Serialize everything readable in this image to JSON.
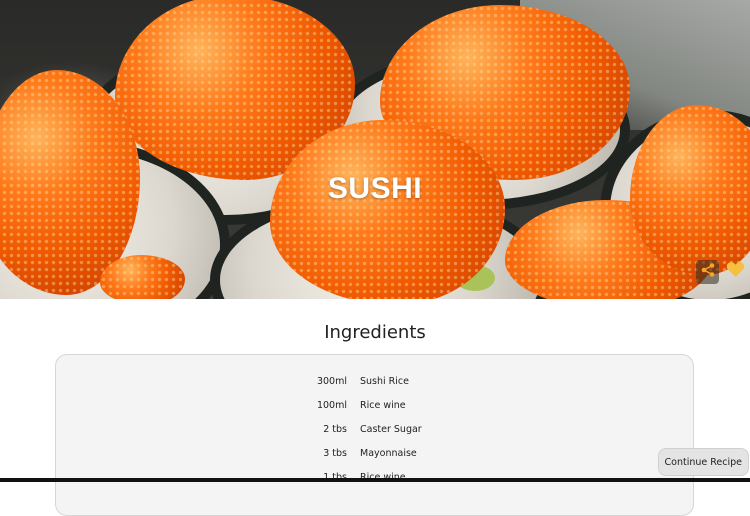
{
  "hero": {
    "title": "SUSHI",
    "share_icon": "share-icon",
    "favorite_icon": "heart-icon",
    "accent_color": "#f5a623"
  },
  "ingredients": {
    "heading": "Ingredients",
    "items": [
      {
        "qty": "300ml",
        "name": "Sushi Rice"
      },
      {
        "qty": "100ml",
        "name": "Rice wine"
      },
      {
        "qty": "2 tbs",
        "name": "Caster Sugar"
      },
      {
        "qty": "3 tbs",
        "name": "Mayonnaise"
      },
      {
        "qty": "1 tbs",
        "name": "Rice wine"
      }
    ]
  },
  "continue_label": "Continue Recipe"
}
